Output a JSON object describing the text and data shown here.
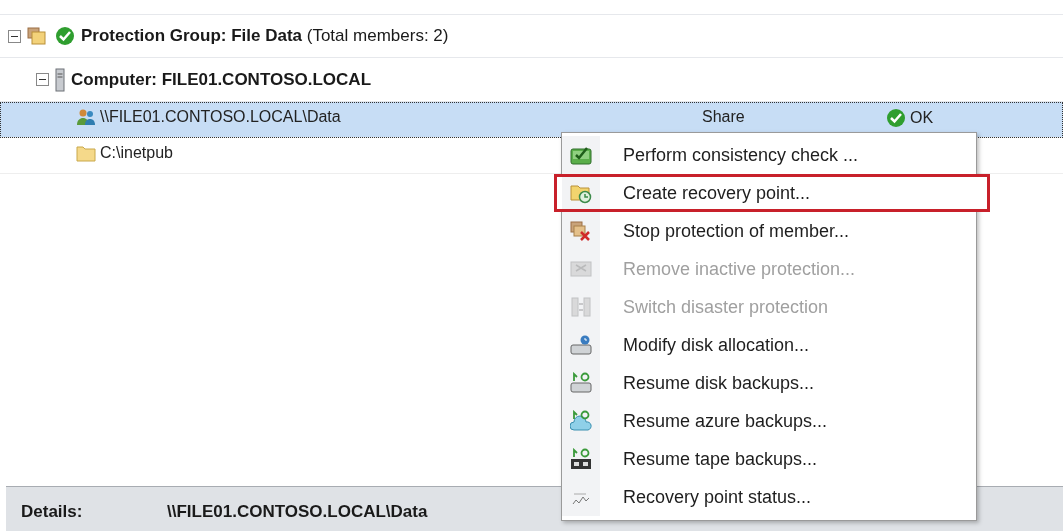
{
  "tree": {
    "kind": "group",
    "expanded": true,
    "label": "**Protection Group: File Data** (Total members: 2)",
    "children": [
      {
        "kind": "computer",
        "expanded": true,
        "label": "Computer: FILE01.CONTOSO.LOCAL",
        "members": [
          {
            "kind": "share",
            "label": "\\\\FILE01.CONTOSO.LOCAL\\Data",
            "type": "Share",
            "status": "OK",
            "selected": true
          },
          {
            "kind": "folder",
            "label": "C:\\inetpub",
            "selected": false
          }
        ]
      }
    ]
  },
  "context_menu": {
    "items": [
      {
        "kind": "check",
        "label": "Perform consistency check ...",
        "disabled": false,
        "highlighted": false
      },
      {
        "kind": "recover",
        "label": "Create recovery point...",
        "disabled": false,
        "highlighted": true
      },
      {
        "kind": "stop",
        "label": "Stop protection of member...",
        "disabled": false,
        "highlighted": false
      },
      {
        "kind": "remove",
        "label": "Remove inactive protection...",
        "disabled": true,
        "highlighted": false
      },
      {
        "kind": "switch",
        "label": "Switch disaster protection",
        "disabled": true,
        "highlighted": false
      },
      {
        "kind": "allocate",
        "label": "Modify disk allocation...",
        "disabled": false,
        "highlighted": false
      },
      {
        "kind": "disk",
        "label": "Resume disk backups...",
        "disabled": false,
        "highlighted": false
      },
      {
        "kind": "azure",
        "label": "Resume azure backups...",
        "disabled": false,
        "highlighted": false
      },
      {
        "kind": "tape",
        "label": "Resume tape backups...",
        "disabled": false,
        "highlighted": false
      },
      {
        "kind": "status",
        "label": "Recovery point status...",
        "disabled": false,
        "highlighted": false
      }
    ]
  },
  "details": {
    "label": "Details:",
    "value": "\\\\FILE01.CONTOSO.LOCAL\\Data"
  }
}
